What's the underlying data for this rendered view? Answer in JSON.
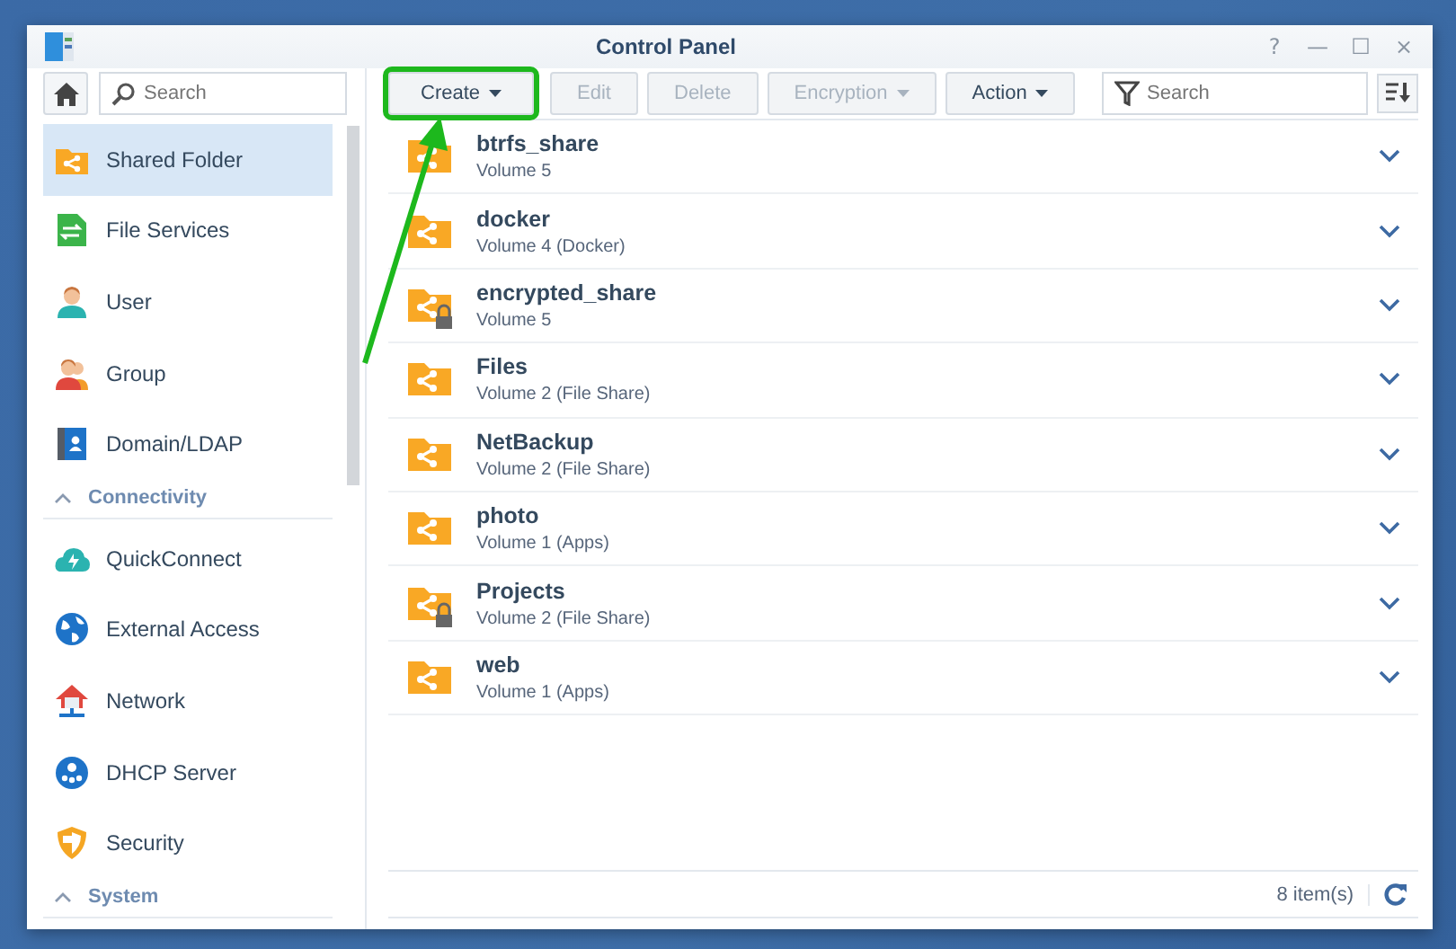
{
  "window": {
    "title": "Control Panel",
    "controls": [
      "?",
      "—",
      "☐",
      "×"
    ]
  },
  "sidebar": {
    "search": {
      "placeholder": "Search"
    },
    "scrolled": true,
    "items": [
      {
        "kind": "item",
        "label": "Shared Folder",
        "selected": true
      },
      {
        "kind": "item",
        "label": "File Services",
        "selected": false
      },
      {
        "kind": "item",
        "label": "User",
        "selected": false
      },
      {
        "kind": "item",
        "label": "Group",
        "selected": false
      },
      {
        "kind": "item",
        "label": "Domain/LDAP",
        "selected": false
      },
      {
        "kind": "header",
        "label": "Connectivity",
        "expanded": true
      },
      {
        "kind": "item",
        "label": "QuickConnect",
        "selected": false
      },
      {
        "kind": "item",
        "label": "External Access",
        "selected": false
      },
      {
        "kind": "item",
        "label": "Network",
        "selected": false
      },
      {
        "kind": "item",
        "label": "DHCP Server",
        "selected": false
      },
      {
        "kind": "item",
        "label": "Security",
        "selected": false
      },
      {
        "kind": "header",
        "label": "System",
        "expanded": true
      }
    ]
  },
  "toolbar": {
    "buttons": [
      {
        "label": "Create",
        "dropdown": true,
        "disabled": false,
        "highlighted": true
      },
      {
        "label": "Edit",
        "dropdown": false,
        "disabled": true,
        "highlighted": false
      },
      {
        "label": "Delete",
        "dropdown": false,
        "disabled": true,
        "highlighted": false
      },
      {
        "label": "Encryption",
        "dropdown": true,
        "disabled": true,
        "highlighted": false
      },
      {
        "label": "Action",
        "dropdown": true,
        "disabled": false,
        "highlighted": false
      }
    ],
    "search": {
      "placeholder": "Search"
    }
  },
  "folders": [
    {
      "name": "btrfs_share",
      "location": "Volume 5",
      "locked": false
    },
    {
      "name": "docker",
      "location": "Volume 4 (Docker)",
      "locked": false
    },
    {
      "name": "encrypted_share",
      "location": "Volume 5",
      "locked": true
    },
    {
      "name": "Files",
      "location": "Volume 2 (File Share)",
      "locked": false
    },
    {
      "name": "NetBackup",
      "location": "Volume 2 (File Share)",
      "locked": false
    },
    {
      "name": "photo",
      "location": "Volume 1 (Apps)",
      "locked": false
    },
    {
      "name": "Projects",
      "location": "Volume 2 (File Share)",
      "locked": true
    },
    {
      "name": "web",
      "location": "Volume 1 (Apps)",
      "locked": false
    }
  ],
  "status_bar": {
    "count": "8 item(s)"
  }
}
